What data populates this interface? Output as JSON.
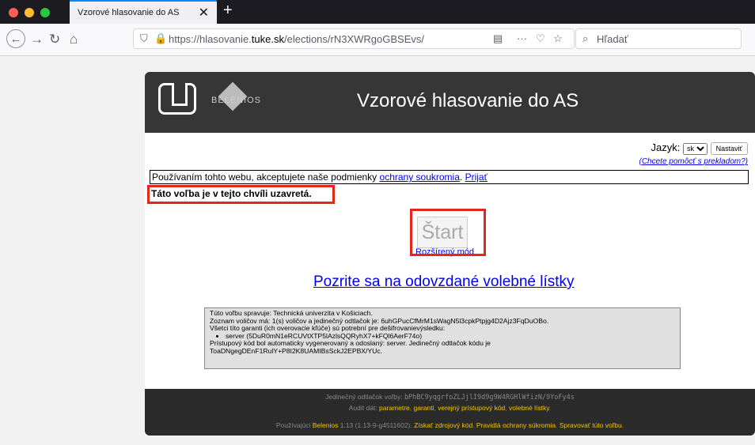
{
  "browser": {
    "tab_title": "Vzorové hlasovanie do AS",
    "tab_close": "✕",
    "new_tab": "+",
    "url_prefix": "https://hlasovanie.",
    "url_domain": "tuke.sk",
    "url_path": "/elections/rN3XWRgoGBSEvs/",
    "search_placeholder": "Hľadať",
    "more_icon": "···"
  },
  "header": {
    "logo_text": "BELENIOS",
    "title": "Vzorové hlasovanie do AS"
  },
  "language": {
    "label": "Jazyk:",
    "selected": "sk",
    "set_button": "Nastaviť",
    "translate_link": "(Chcete pomôcť s prekladom?)"
  },
  "cookie": {
    "text": "Používaním tohto webu, akceptujete naše podmienky ",
    "privacy_link": "ochrany soukromia",
    "sep": ". ",
    "accept_link": "Prijať"
  },
  "status": {
    "closed_message": "Táto voľba je v tejto chvíli uzavretá."
  },
  "actions": {
    "start_button": "Štart",
    "advanced_link": "Rozšírený mód",
    "ballots_link": "Pozrite sa na odovzdané volebné lístky"
  },
  "info": {
    "line1": "Túto voľbu spravuje: Technická univerzita v Košiciach.",
    "line2": "Zoznam voličov má: 1(s) voličov a jedinečný odtlačok je: 6uhGPucCfMrM1sWagN5l3cpkPtpjg4D2Ajz3FqDuOBo.",
    "line3": "Všetci títo garanti (ich overovacie kľúče) sú potrební pre dešifrovanievýsledku:",
    "trustee": "server (5DuR0mN1eRCUVtXTP5lAzlsQQRyhX7+kFQl6AerF74o)",
    "line4": "Prístupový kód bol automaticky vygenerovaný a odoslaný: server. Jedinečný odtlačok kódu je",
    "line5": "ToaDNgegDEnF1RulY+P8I2K8UAMIBsSckJ2EPBX/YUc."
  },
  "footer": {
    "fingerprint_label": "Jedinečný odtlačok voľby: ",
    "fingerprint": "bPhBC9yqgrfoZLJjlI9d9g9W4RGHlWfizN/9YoFy4s",
    "audit_label": "Audit dát: ",
    "audit_parameters": "parametre",
    "audit_trustees": "garanti",
    "audit_public_creds": "verejný prístupový kód",
    "audit_ballots": "volebné lístky",
    "powered_by": "Používajúci ",
    "belenios": "Belenios",
    "version": " 1.13 (1.13-9-g4511602). ",
    "source_link": "Získať zdrojový kód",
    "privacy_link": "Pravidlá ochrany súkromia",
    "admin_link": "Spravovať túto voľbu"
  }
}
